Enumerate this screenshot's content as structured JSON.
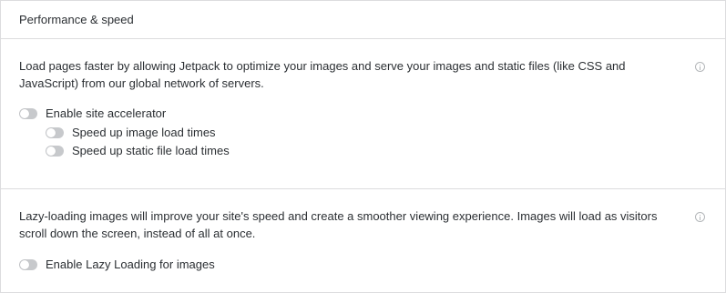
{
  "header": {
    "title": "Performance & speed"
  },
  "accelerator_card": {
    "description": "Load pages faster by allowing Jetpack to optimize your images and serve your images and static files (like CSS and JavaScript) from our global network of servers.",
    "info_icon": "info-icon",
    "toggles": [
      {
        "label": "Enable site accelerator",
        "enabled": false
      },
      {
        "label": "Speed up image load times",
        "enabled": false
      },
      {
        "label": "Speed up static file load times",
        "enabled": false
      }
    ]
  },
  "lazy_card": {
    "description": "Lazy-loading images will improve your site's speed and create a smoother viewing experience. Images will load as visitors scroll down the screen, instead of all at once.",
    "info_icon": "info-icon",
    "toggles": [
      {
        "label": "Enable Lazy Loading for images",
        "enabled": false
      }
    ]
  },
  "colors": {
    "toggle_off": "#c7c9cc",
    "border": "#dcdcde",
    "text": "#2b2f33"
  }
}
